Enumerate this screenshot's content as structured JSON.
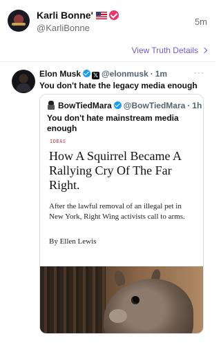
{
  "post": {
    "display_name": "Karli Bonne'",
    "handle": "@KarliBonne",
    "timestamp": "5m",
    "view_details_label": "View Truth Details"
  },
  "embed": {
    "name": "Elon Musk",
    "handle": "@elonmusk",
    "separator": "·",
    "time": "1m",
    "text": "You don't hate the legacy media enough",
    "more_icon": "more-horizontal-icon"
  },
  "quote": {
    "name": "BowTiedMara",
    "handle": "@BowTiedMara",
    "separator": "·",
    "time": "1h",
    "text": "You don't hate mainstream media enough"
  },
  "article": {
    "tag": "IDEAS",
    "title": "How A Squirrel Became A Rallying Cry Of The Far Right.",
    "description": "After the lawful removal of an illegal pet in New York, Right Wing activists call to arms.",
    "author": "By Ellen Lewis"
  },
  "colors": {
    "accent": "#6b5bd6",
    "verified_pink": "#e8396a",
    "verified_blue": "#1d9bf0",
    "tag_red": "#d0334a"
  }
}
